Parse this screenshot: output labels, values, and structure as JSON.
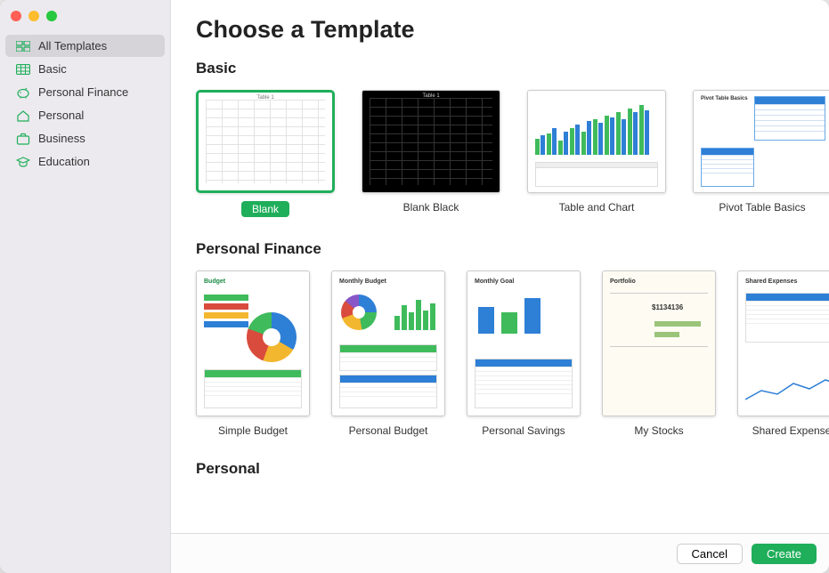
{
  "header": {
    "title": "Choose a Template"
  },
  "sidebar": {
    "items": [
      {
        "label": "All Templates",
        "icon": "grid-icon",
        "selected": true
      },
      {
        "label": "Basic",
        "icon": "spreadsheet-icon",
        "selected": false
      },
      {
        "label": "Personal Finance",
        "icon": "piggy-bank-icon",
        "selected": false
      },
      {
        "label": "Personal",
        "icon": "home-icon",
        "selected": false
      },
      {
        "label": "Business",
        "icon": "briefcase-icon",
        "selected": false
      },
      {
        "label": "Education",
        "icon": "graduation-cap-icon",
        "selected": false
      }
    ]
  },
  "sections": [
    {
      "title": "Basic",
      "templates": [
        {
          "label": "Blank",
          "selected": true,
          "preview": "blank-grid"
        },
        {
          "label": "Blank Black",
          "selected": false,
          "preview": "blank-grid-black"
        },
        {
          "label": "Table and Chart",
          "selected": false,
          "preview": "table-and-chart"
        },
        {
          "label": "Pivot Table Basics",
          "selected": false,
          "preview": "pivot"
        }
      ]
    },
    {
      "title": "Personal Finance",
      "templates": [
        {
          "label": "Simple Budget",
          "selected": false,
          "preview": "simple-budget"
        },
        {
          "label": "Personal Budget",
          "selected": false,
          "preview": "personal-budget"
        },
        {
          "label": "Personal Savings",
          "selected": false,
          "preview": "personal-savings"
        },
        {
          "label": "My Stocks",
          "selected": false,
          "preview": "my-stocks"
        },
        {
          "label": "Shared Expenses",
          "selected": false,
          "preview": "shared-expenses"
        }
      ]
    },
    {
      "title": "Personal",
      "templates": []
    }
  ],
  "footer": {
    "cancel": "Cancel",
    "create": "Create"
  },
  "colors": {
    "accent": "#1fae5a",
    "blue": "#2e7fd6",
    "green": "#3fbb5c",
    "yellow": "#f3b72f",
    "red": "#d94c3d"
  },
  "preview_text": {
    "blank_tab": "Table 1",
    "pivot_head": "Pivot Table Basics",
    "budget_head": "Budget",
    "monthly_budget": "Monthly Budget",
    "monthly_goal": "Monthly Goal",
    "portfolio": "Portfolio",
    "shared": "Shared Expenses",
    "stock_amount": "$1134136"
  }
}
